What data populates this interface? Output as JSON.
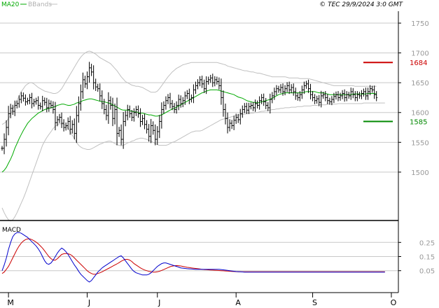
{
  "header": {
    "legend_ma": "MA20",
    "legend_bbands": "BBands",
    "copyright": "© TEC 29/9/2024 3:0 GMT"
  },
  "macd_label": "MACD",
  "colors": {
    "price": "#000000",
    "ma20": "#00aa00",
    "bbands": "#c0c0c0",
    "resistance": "#cc0000",
    "support": "#008800",
    "macd": "#0000cc",
    "signal": "#cc0000",
    "grid": "#c8c8c8"
  },
  "chart_data": [
    {
      "type": "line",
      "title": "",
      "price_unit_note": "OHLC bars with MA20 and Bollinger Bands",
      "ylim": [
        1420,
        1770
      ],
      "ytick_values": [
        1500,
        1550,
        1600,
        1650,
        1700,
        1750
      ],
      "ytick_labels": [
        "1500",
        "1550",
        "1600",
        "1650",
        "1700",
        "1750"
      ],
      "x_month_labels": [
        "M",
        "J",
        "J",
        "A",
        "S",
        "O"
      ],
      "x_month_index": [
        3,
        40,
        73,
        110,
        146,
        183
      ],
      "x_total": 185,
      "levels": [
        {
          "name": "resistance",
          "value": 1684,
          "label": "1684"
        },
        {
          "name": "support",
          "value": 1585,
          "label": "1585"
        }
      ],
      "close": [
        1540,
        1555,
        1575,
        1598,
        1607,
        1602,
        1612,
        1615,
        1622,
        1628,
        1624,
        1618,
        1620,
        1625,
        1615,
        1618,
        1620,
        1612,
        1610,
        1620,
        1617,
        1608,
        1615,
        1612,
        1605,
        1583,
        1588,
        1592,
        1582,
        1575,
        1578,
        1585,
        1572,
        1580,
        1565,
        1595,
        1615,
        1635,
        1655,
        1648,
        1660,
        1675,
        1668,
        1650,
        1643,
        1640,
        1628,
        1615,
        1605,
        1595,
        1620,
        1612,
        1590,
        1605,
        1565,
        1570,
        1555,
        1585,
        1595,
        1605,
        1598,
        1592,
        1600,
        1605,
        1598,
        1585,
        1590,
        1580,
        1572,
        1560,
        1578,
        1570,
        1555,
        1568,
        1585,
        1605,
        1612,
        1620,
        1625,
        1615,
        1610,
        1605,
        1612,
        1622,
        1615,
        1620,
        1628,
        1632,
        1622,
        1625,
        1638,
        1645,
        1650,
        1655,
        1648,
        1640,
        1652,
        1655,
        1658,
        1650,
        1655,
        1652,
        1645,
        1625,
        1605,
        1590,
        1575,
        1582,
        1578,
        1587,
        1592,
        1588,
        1598,
        1605,
        1610,
        1604,
        1610,
        1612,
        1608,
        1615,
        1612,
        1620,
        1625,
        1618,
        1612,
        1608,
        1622,
        1628,
        1635,
        1640,
        1638,
        1642,
        1635,
        1640,
        1645,
        1638,
        1642,
        1635,
        1628,
        1625,
        1630,
        1638,
        1645,
        1648,
        1640,
        1630,
        1625,
        1620,
        1623,
        1617,
        1628,
        1630,
        1625,
        1620,
        1618,
        1622,
        1627,
        1630,
        1625,
        1628,
        1632,
        1625,
        1630,
        1628,
        1635,
        1630,
        1625,
        1630,
        1628,
        1632,
        1635,
        1628,
        1635,
        1640,
        1638,
        1630,
        1625
      ],
      "ma20": [
        1500,
        1503,
        1508,
        1515,
        1522,
        1530,
        1540,
        1548,
        1556,
        1563,
        1570,
        1576,
        1582,
        1586,
        1590,
        1593,
        1596,
        1599,
        1601,
        1603,
        1605,
        1606,
        1607,
        1608,
        1609,
        1610,
        1612,
        1613,
        1614,
        1614,
        1613,
        1612,
        1612,
        1613,
        1614,
        1616,
        1617,
        1618,
        1620,
        1621,
        1622,
        1623,
        1623,
        1622,
        1621,
        1620,
        1619,
        1618,
        1618,
        1617,
        1616,
        1615,
        1613,
        1611,
        1609,
        1607,
        1605,
        1604,
        1604,
        1604,
        1603,
        1602,
        1601,
        1601,
        1600,
        1599,
        1599,
        1598,
        1597,
        1596,
        1596,
        1595,
        1594,
        1594,
        1595,
        1596,
        1598,
        1600,
        1602,
        1604,
        1606,
        1607,
        1609,
        1611,
        1613,
        1615,
        1617,
        1619,
        1621,
        1623,
        1625,
        1627,
        1629,
        1631,
        1633,
        1634,
        1636,
        1637,
        1638,
        1638,
        1638,
        1638,
        1637,
        1636,
        1635,
        1634,
        1633,
        1632,
        1631,
        1630,
        1628,
        1626,
        1625,
        1624,
        1622,
        1620,
        1619,
        1618,
        1617,
        1617,
        1616,
        1617,
        1618,
        1619,
        1620,
        1621,
        1622,
        1624,
        1626,
        1628,
        1630,
        1631,
        1632,
        1633,
        1633,
        1633,
        1633,
        1633,
        1633,
        1633,
        1633,
        1633,
        1634,
        1635,
        1635,
        1635,
        1635,
        1635,
        1634,
        1633,
        1633,
        1633,
        1632,
        1631,
        1630,
        1630,
        1630,
        1630,
        1630,
        1630,
        1630,
        1630,
        1630,
        1630,
        1630,
        1631,
        1631,
        1631,
        1631,
        1631,
        1631,
        1631,
        1632,
        1632,
        1632,
        1632,
        1631
      ],
      "bb_upper": [
        1580,
        1582,
        1585,
        1590,
        1597,
        1605,
        1613,
        1620,
        1628,
        1635,
        1640,
        1645,
        1648,
        1650,
        1650,
        1648,
        1645,
        1642,
        1640,
        1638,
        1636,
        1635,
        1634,
        1633,
        1632,
        1632,
        1633,
        1636,
        1640,
        1646,
        1652,
        1658,
        1664,
        1670,
        1676,
        1682,
        1688,
        1693,
        1697,
        1700,
        1702,
        1703,
        1702,
        1700,
        1698,
        1695,
        1692,
        1690,
        1688,
        1686,
        1684,
        1682,
        1678,
        1674,
        1670,
        1665,
        1660,
        1656,
        1652,
        1650,
        1648,
        1646,
        1645,
        1644,
        1644,
        1643,
        1642,
        1640,
        1638,
        1636,
        1634,
        1634,
        1634,
        1636,
        1640,
        1645,
        1650,
        1655,
        1660,
        1664,
        1668,
        1671,
        1674,
        1676,
        1678,
        1680,
        1681,
        1682,
        1683,
        1684,
        1684,
        1684,
        1684,
        1684,
        1684,
        1684,
        1684,
        1684,
        1684,
        1684,
        1684,
        1684,
        1683,
        1682,
        1681,
        1680,
        1678,
        1677,
        1676,
        1675,
        1674,
        1673,
        1672,
        1671,
        1670,
        1670,
        1669,
        1668,
        1668,
        1667,
        1666,
        1666,
        1665,
        1664,
        1663,
        1662,
        1661,
        1660,
        1660,
        1660,
        1660,
        1660,
        1660,
        1660,
        1659,
        1658,
        1658,
        1658,
        1658,
        1658,
        1657,
        1657,
        1657,
        1657,
        1657,
        1656,
        1655,
        1654,
        1653,
        1652,
        1651,
        1650,
        1649,
        1648,
        1647,
        1646,
        1645,
        1645,
        1645,
        1645,
        1645,
        1645,
        1645,
        1645,
        1645,
        1645,
        1644,
        1644,
        1644,
        1644,
        1644,
        1644,
        1644,
        1644,
        1644,
        1644,
        1644
      ],
      "bb_lower": [
        1440,
        1432,
        1425,
        1420,
        1418,
        1420,
        1425,
        1432,
        1440,
        1448,
        1456,
        1465,
        1475,
        1485,
        1495,
        1505,
        1515,
        1525,
        1535,
        1545,
        1552,
        1558,
        1563,
        1568,
        1573,
        1577,
        1580,
        1581,
        1581,
        1580,
        1578,
        1574,
        1568,
        1562,
        1556,
        1550,
        1545,
        1542,
        1540,
        1539,
        1538,
        1538,
        1539,
        1541,
        1543,
        1545,
        1547,
        1548,
        1550,
        1551,
        1552,
        1552,
        1550,
        1548,
        1546,
        1545,
        1544,
        1545,
        1547,
        1549,
        1550,
        1552,
        1553,
        1555,
        1556,
        1557,
        1557,
        1556,
        1555,
        1553,
        1552,
        1550,
        1548,
        1546,
        1545,
        1545,
        1545,
        1545,
        1546,
        1548,
        1550,
        1551,
        1553,
        1555,
        1557,
        1559,
        1561,
        1563,
        1565,
        1567,
        1568,
        1569,
        1569,
        1569,
        1570,
        1572,
        1574,
        1576,
        1578,
        1580,
        1582,
        1584,
        1586,
        1588,
        1589,
        1590,
        1591,
        1592,
        1593,
        1594,
        1595,
        1596,
        1596,
        1597,
        1597,
        1598,
        1598,
        1599,
        1599,
        1600,
        1600,
        1601,
        1602,
        1602,
        1603,
        1603,
        1604,
        1605,
        1605,
        1606,
        1606,
        1607,
        1607,
        1608,
        1608,
        1608,
        1609,
        1609,
        1609,
        1610,
        1610,
        1610,
        1611,
        1611,
        1611,
        1611,
        1612,
        1612,
        1612,
        1613,
        1613,
        1613,
        1613,
        1614,
        1614,
        1614,
        1614,
        1614,
        1615,
        1615,
        1615,
        1615,
        1615,
        1615,
        1615,
        1615,
        1615,
        1615,
        1615,
        1615,
        1616,
        1616,
        1616,
        1616,
        1616,
        1616,
        1616,
        1616,
        1616,
        1616,
        1616
      ]
    },
    {
      "type": "line",
      "title": "MACD",
      "ylim": [
        -0.1,
        0.4
      ],
      "ytick_values": [
        0.05,
        0.15,
        0.25
      ],
      "ytick_labels": [
        "0.05",
        "0.15",
        "0.25"
      ],
      "series": [
        {
          "name": "MACD",
          "values": [
            0.05,
            0.09,
            0.14,
            0.2,
            0.25,
            0.29,
            0.31,
            0.32,
            0.32,
            0.315,
            0.305,
            0.295,
            0.285,
            0.27,
            0.255,
            0.24,
            0.225,
            0.205,
            0.18,
            0.15,
            0.12,
            0.1,
            0.095,
            0.105,
            0.125,
            0.15,
            0.175,
            0.195,
            0.21,
            0.2,
            0.185,
            0.165,
            0.14,
            0.115,
            0.09,
            0.07,
            0.045,
            0.025,
            0.01,
            -0.005,
            -0.02,
            -0.03,
            -0.02,
            0.0,
            0.02,
            0.04,
            0.055,
            0.07,
            0.08,
            0.09,
            0.1,
            0.11,
            0.12,
            0.13,
            0.14,
            0.15,
            0.155,
            0.14,
            0.12,
            0.1,
            0.08,
            0.06,
            0.045,
            0.035,
            0.03,
            0.025,
            0.02,
            0.02,
            0.02,
            0.025,
            0.035,
            0.05,
            0.065,
            0.08,
            0.09,
            0.1,
            0.105,
            0.105,
            0.1,
            0.095,
            0.09,
            0.085,
            0.08,
            0.075,
            0.07,
            0.068,
            0.066,
            0.064,
            0.063,
            0.062,
            0.061,
            0.06,
            0.06,
            0.06,
            0.06,
            0.06,
            0.06,
            0.06,
            0.06,
            0.06,
            0.06,
            0.06,
            0.06,
            0.058,
            0.056,
            0.054,
            0.052,
            0.05,
            0.048,
            0.046,
            0.044,
            0.043,
            0.042,
            0.041,
            0.04,
            0.04,
            0.04,
            0.04,
            0.04,
            0.04,
            0.04,
            0.04,
            0.04,
            0.04,
            0.04,
            0.04,
            0.04,
            0.04,
            0.04,
            0.04,
            0.04,
            0.04,
            0.04,
            0.04,
            0.04,
            0.04,
            0.04,
            0.04,
            0.04,
            0.04,
            0.04,
            0.04,
            0.04,
            0.04,
            0.04,
            0.04,
            0.04,
            0.04,
            0.04,
            0.04,
            0.04,
            0.04,
            0.04,
            0.04,
            0.04,
            0.04,
            0.04,
            0.04,
            0.04,
            0.04,
            0.04,
            0.04,
            0.04,
            0.04,
            0.04,
            0.04,
            0.04,
            0.04,
            0.04,
            0.04,
            0.04,
            0.04,
            0.04,
            0.04,
            0.04,
            0.04,
            0.04,
            0.04,
            0.04,
            0.04,
            0.04
          ]
        },
        {
          "name": "Signal",
          "values": [
            0.03,
            0.04,
            0.06,
            0.08,
            0.11,
            0.14,
            0.17,
            0.2,
            0.225,
            0.245,
            0.26,
            0.27,
            0.275,
            0.275,
            0.27,
            0.262,
            0.252,
            0.24,
            0.225,
            0.21,
            0.19,
            0.17,
            0.15,
            0.135,
            0.125,
            0.125,
            0.135,
            0.15,
            0.165,
            0.17,
            0.172,
            0.17,
            0.165,
            0.155,
            0.14,
            0.125,
            0.11,
            0.095,
            0.08,
            0.065,
            0.05,
            0.038,
            0.03,
            0.025,
            0.025,
            0.03,
            0.035,
            0.042,
            0.05,
            0.058,
            0.066,
            0.074,
            0.082,
            0.09,
            0.098,
            0.107,
            0.117,
            0.125,
            0.13,
            0.13,
            0.125,
            0.115,
            0.1,
            0.09,
            0.08,
            0.07,
            0.062,
            0.055,
            0.05,
            0.045,
            0.042,
            0.04,
            0.04,
            0.042,
            0.046,
            0.052,
            0.058,
            0.065,
            0.072,
            0.078,
            0.082,
            0.085,
            0.086,
            0.085,
            0.083,
            0.08,
            0.077,
            0.074,
            0.072,
            0.07,
            0.068,
            0.066,
            0.064,
            0.062,
            0.06,
            0.058,
            0.057,
            0.056,
            0.055,
            0.054,
            0.053,
            0.052,
            0.051,
            0.05,
            0.049,
            0.048,
            0.047,
            0.046,
            0.045,
            0.044,
            0.043,
            0.042,
            0.042,
            0.042,
            0.042,
            0.042,
            0.042,
            0.042,
            0.042,
            0.042,
            0.042,
            0.042,
            0.042,
            0.042,
            0.042,
            0.042,
            0.042,
            0.042,
            0.042,
            0.042,
            0.042,
            0.042,
            0.042,
            0.042,
            0.042,
            0.042,
            0.042,
            0.042,
            0.042,
            0.042,
            0.042,
            0.042,
            0.042,
            0.042,
            0.042,
            0.042,
            0.042,
            0.042,
            0.042,
            0.042,
            0.042,
            0.042,
            0.042,
            0.042,
            0.042,
            0.042,
            0.042,
            0.042,
            0.042,
            0.042,
            0.042,
            0.042,
            0.042,
            0.042,
            0.042,
            0.042,
            0.042,
            0.042,
            0.042,
            0.042,
            0.042,
            0.042,
            0.042,
            0.042,
            0.042,
            0.042,
            0.042,
            0.042,
            0.042,
            0.042,
            0.042
          ]
        }
      ]
    }
  ]
}
